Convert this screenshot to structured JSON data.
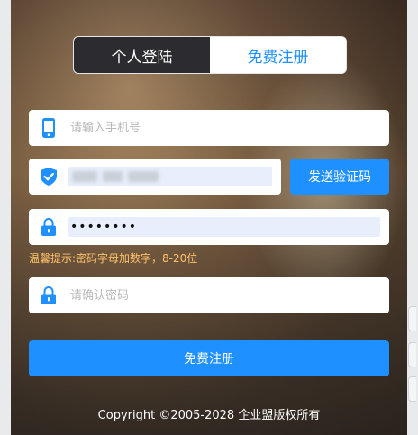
{
  "tabs": {
    "login": "个人登陆",
    "register": "免费注册"
  },
  "phone": {
    "placeholder": "请输入手机号",
    "icon": "phone-icon"
  },
  "code": {
    "icon": "shield-check-icon",
    "send_button": "发送验证码"
  },
  "password": {
    "value": "••••••••",
    "icon": "lock-icon"
  },
  "hint": "温馨提示:密码字母加数字，8-20位",
  "confirm": {
    "placeholder": "请确认密码",
    "icon": "lock-icon"
  },
  "submit_label": "免费注册",
  "footer": "Copyright ©2005-2028 企业盟版权所有",
  "colors": {
    "accent": "#1e90ff",
    "active_tab_bg": "#2c2c30",
    "hint": "#ffc06a"
  }
}
